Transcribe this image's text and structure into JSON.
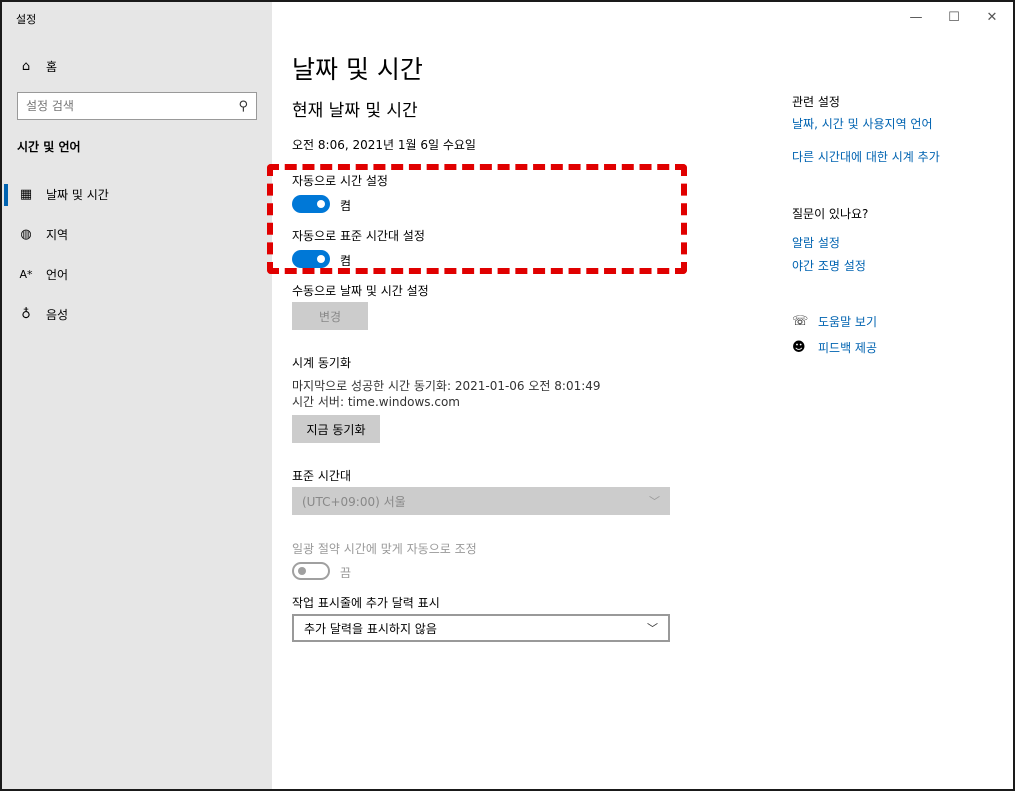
{
  "window": {
    "app_title": "설정",
    "minimize_icon": "minimize-icon",
    "maximize_icon": "maximize-icon",
    "close_icon": "close-icon"
  },
  "sidebar": {
    "home_label": "홈",
    "search": {
      "placeholder": "설정 검색"
    },
    "section_title": "시간 및 언어",
    "items": [
      {
        "label": "날짜 및 시간",
        "icon": "calendar-clock-icon",
        "active": true
      },
      {
        "label": "지역",
        "icon": "globe-icon"
      },
      {
        "label": "언어",
        "icon": "language-icon"
      },
      {
        "label": "음성",
        "icon": "microphone-icon"
      }
    ]
  },
  "main": {
    "page_title": "날짜 및 시간",
    "current_heading": "현재 날짜 및 시간",
    "current_datetime": "오전 8:06, 2021년 1월 6일 수요일",
    "auto_time": {
      "label": "자동으로 시간 설정",
      "state": "켬"
    },
    "auto_timezone": {
      "label": "자동으로 표준 시간대 설정",
      "state": "켬"
    },
    "manual": {
      "label": "수동으로 날짜 및 시간 설정",
      "button": "변경"
    },
    "sync": {
      "heading": "시계 동기화",
      "last_sync": "마지막으로 성공한 시간 동기화: 2021-01-06 오전 8:01:49",
      "server": "시간 서버: time.windows.com",
      "button": "지금 동기화"
    },
    "timezone": {
      "label": "표준 시간대",
      "value": "(UTC+09:00) 서울"
    },
    "dst": {
      "label": "일광 절약 시간에 맞게 자동으로 조정",
      "state": "끔"
    },
    "calendar": {
      "label": "작업 표시줄에 추가 달력 표시",
      "value": "추가 달력을 표시하지 않음"
    }
  },
  "related": {
    "heading": "관련 설정",
    "links": [
      "날짜, 시간 및 사용지역 언어",
      "다른 시간대에 대한 시계 추가"
    ],
    "question_heading": "질문이 있나요?",
    "question_links": [
      "알람 설정",
      "야간 조명 설정"
    ],
    "help_label": "도움말 보기",
    "feedback_label": "피드백 제공"
  },
  "colors": {
    "accent": "#0078d7",
    "link": "#0063b1",
    "highlight_border": "#e00000",
    "sidebar_bg": "#e6e6e6"
  }
}
